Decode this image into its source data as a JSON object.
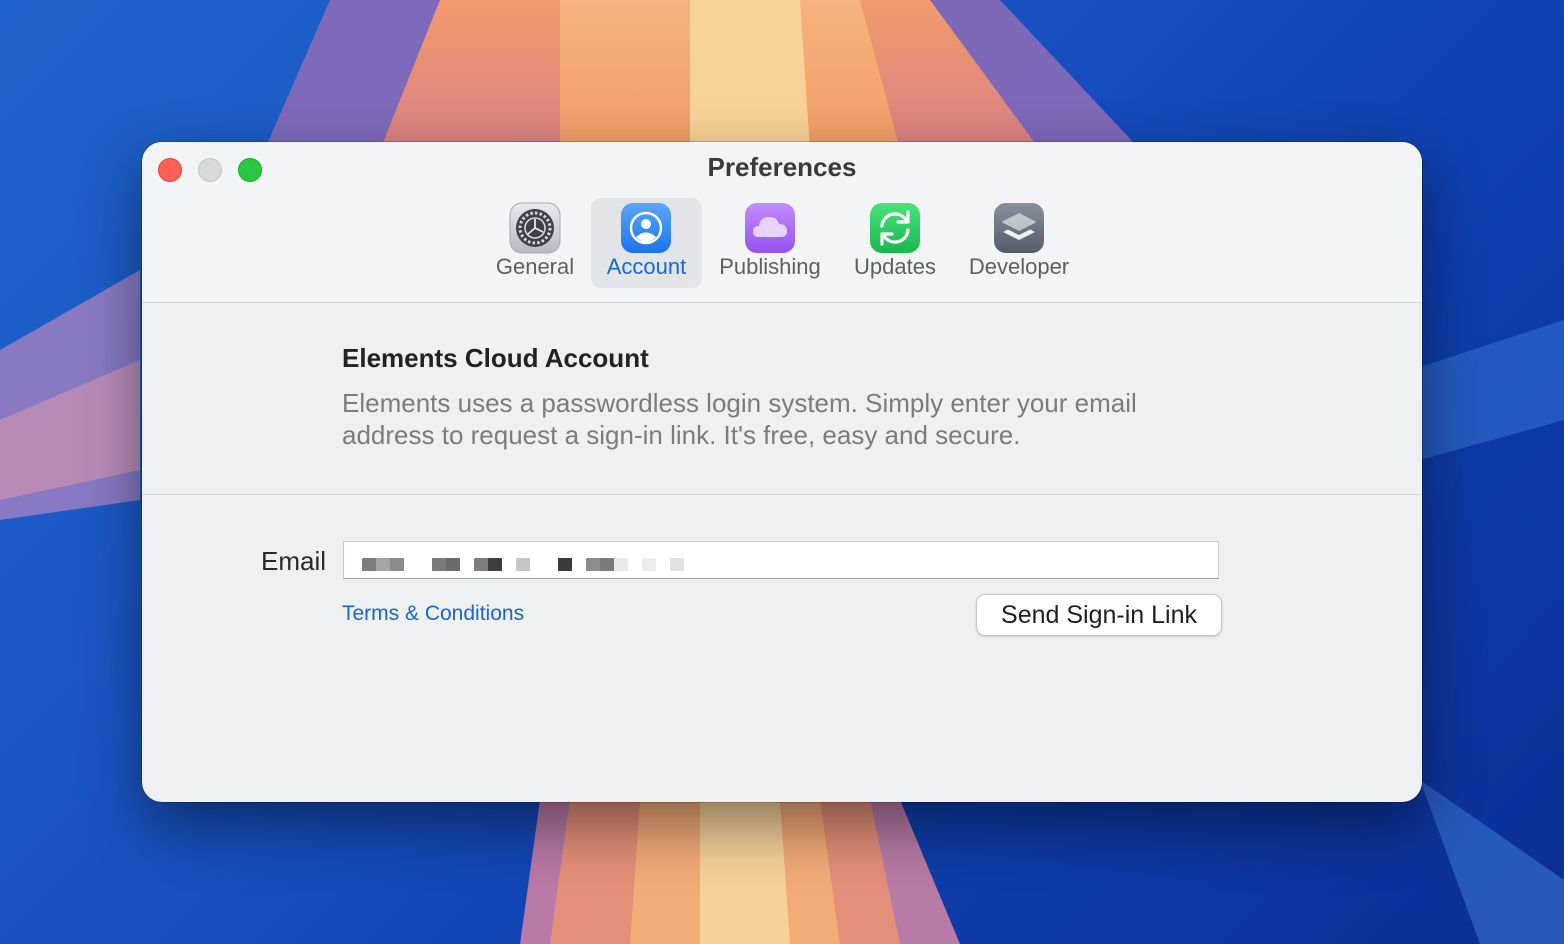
{
  "window": {
    "title": "Preferences"
  },
  "toolbar": {
    "tabs": [
      {
        "label": "General",
        "icon": "gear-icon",
        "selected": false
      },
      {
        "label": "Account",
        "icon": "person-icon",
        "selected": true
      },
      {
        "label": "Publishing",
        "icon": "cloud-icon",
        "selected": false
      },
      {
        "label": "Updates",
        "icon": "refresh-icon",
        "selected": false
      },
      {
        "label": "Developer",
        "icon": "layers-icon",
        "selected": false
      }
    ]
  },
  "account": {
    "heading": "Elements Cloud Account",
    "description": "Elements uses a passwordless login system. Simply enter your email address to request a sign-in link. It's free, easy and secure.",
    "email_label": "Email",
    "email_value": "",
    "terms_link": "Terms & Conditions",
    "send_button": "Send Sign-in Link"
  },
  "colors": {
    "accent": "#1769d6",
    "link": "#1766d1",
    "window_bg": "#eff0f2",
    "close": "#fe5f57",
    "maximize": "#28c840"
  }
}
